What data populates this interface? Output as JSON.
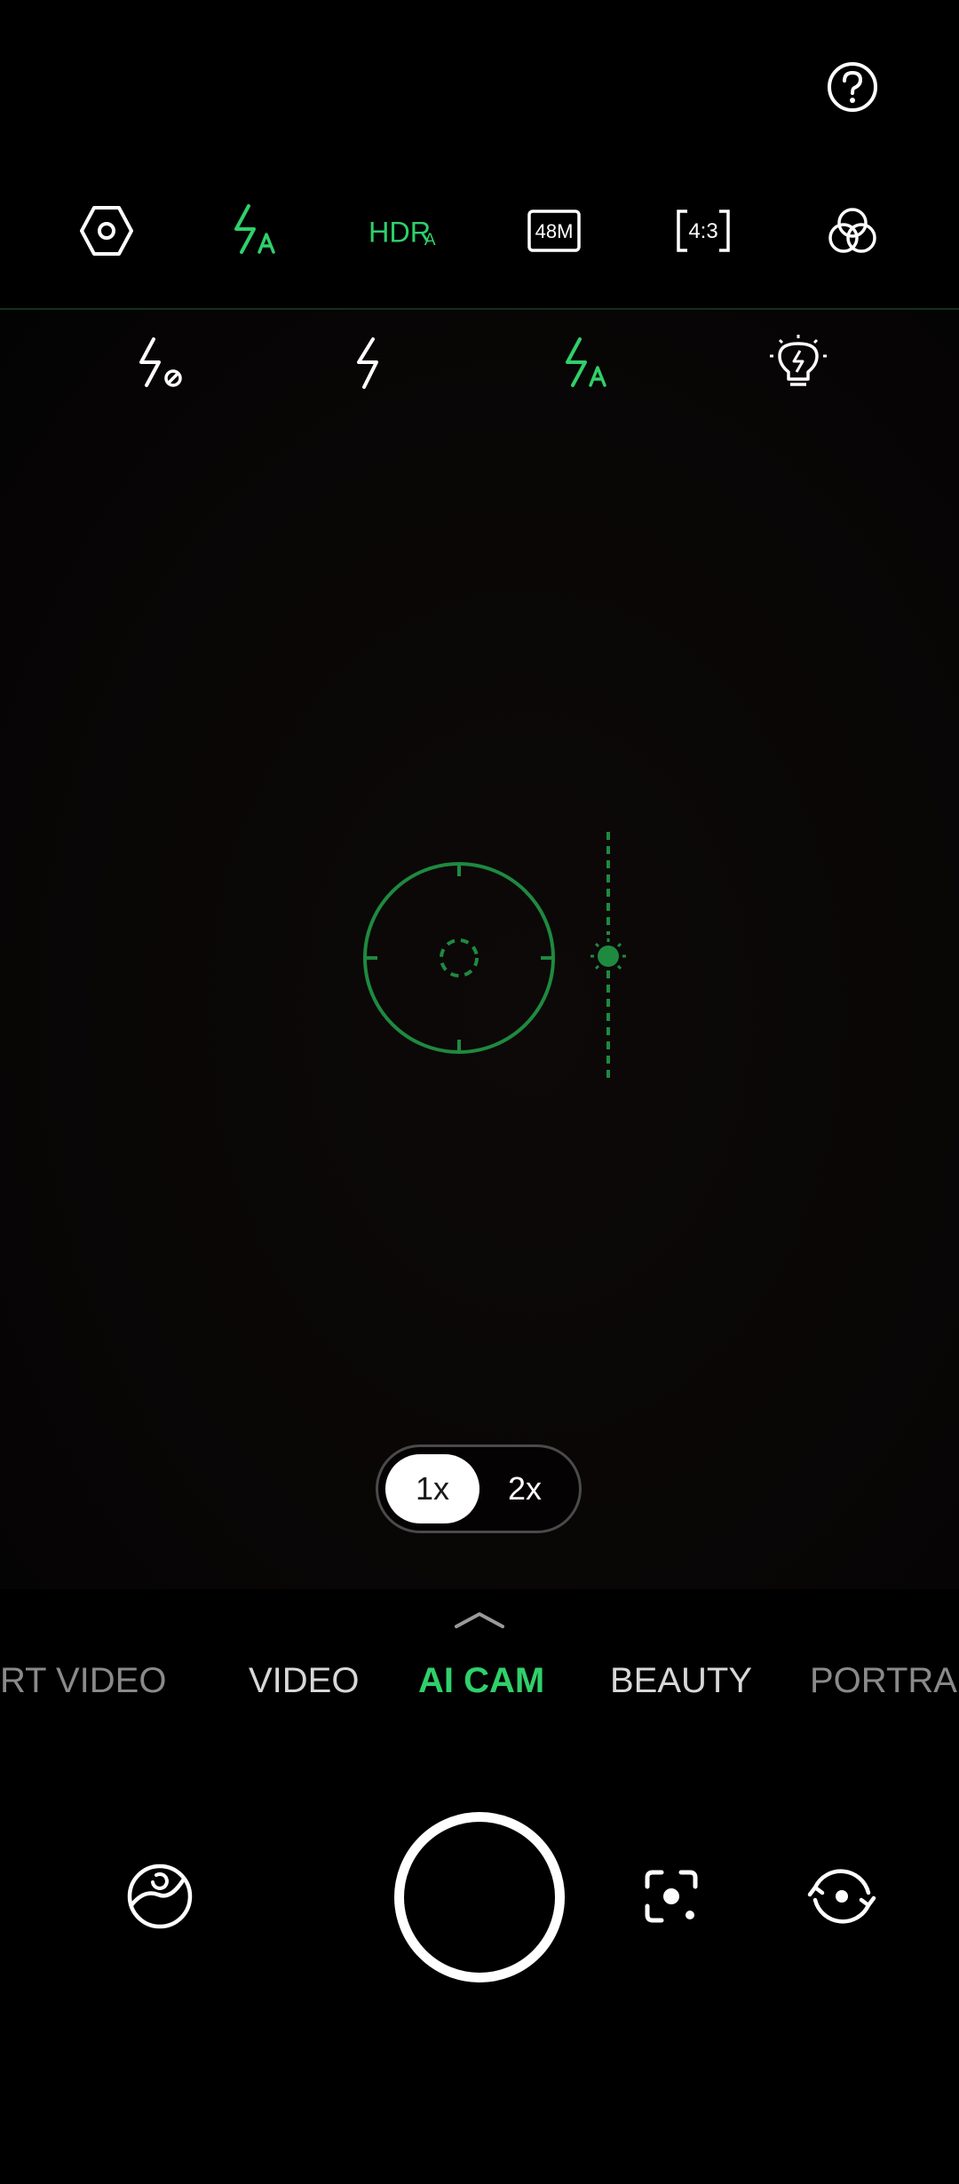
{
  "top_bar": {
    "help_icon": "question-circle-icon"
  },
  "toolbar": {
    "items": [
      {
        "name": "settings",
        "icon": "settings-hexagon-icon"
      },
      {
        "name": "flash",
        "icon": "flash-auto-icon",
        "state": "auto"
      },
      {
        "name": "hdr",
        "label": "HDR",
        "suffix": "A",
        "icon": "hdr-auto-icon"
      },
      {
        "name": "resolution",
        "label": "48M",
        "icon": "resolution-48m-icon"
      },
      {
        "name": "aspect_ratio",
        "label": "4:3",
        "icon": "aspect-ratio-icon"
      },
      {
        "name": "filters",
        "icon": "filters-icon"
      }
    ]
  },
  "flash_menu": {
    "options": [
      {
        "name": "flash-off",
        "icon": "flash-off-icon",
        "selected": false
      },
      {
        "name": "flash-on",
        "icon": "flash-on-icon",
        "selected": false
      },
      {
        "name": "flash-auto",
        "icon": "flash-auto-icon",
        "selected": true
      },
      {
        "name": "torch",
        "icon": "torch-bulb-icon",
        "selected": false
      }
    ]
  },
  "viewfinder": {
    "focus_icon": "focus-ring-icon",
    "exposure_icon": "exposure-sun-icon"
  },
  "zoom": {
    "options": [
      {
        "label": "1x",
        "active": true
      },
      {
        "label": "2x",
        "active": false
      }
    ]
  },
  "modes": {
    "expand_icon": "chevron-up-icon",
    "items": [
      "PORT VIDEO",
      "VIDEO",
      "AI CAM",
      "BEAUTY",
      "PORTRAIT"
    ],
    "visible_items": [
      "RT VIDEO",
      "VIDEO",
      "AI CAM",
      "BEAUTY",
      "PORTRA"
    ],
    "active": "AI CAM"
  },
  "controls": {
    "gallery_icon": "gallery-thumbnail-icon",
    "shutter_icon": "shutter-button-icon",
    "lens_icon": "google-lens-icon",
    "switch_icon": "switch-camera-icon"
  },
  "colors": {
    "accent": "#2fd06a",
    "focus": "#1e8a3f",
    "background": "#000000",
    "icon": "#ffffff"
  }
}
